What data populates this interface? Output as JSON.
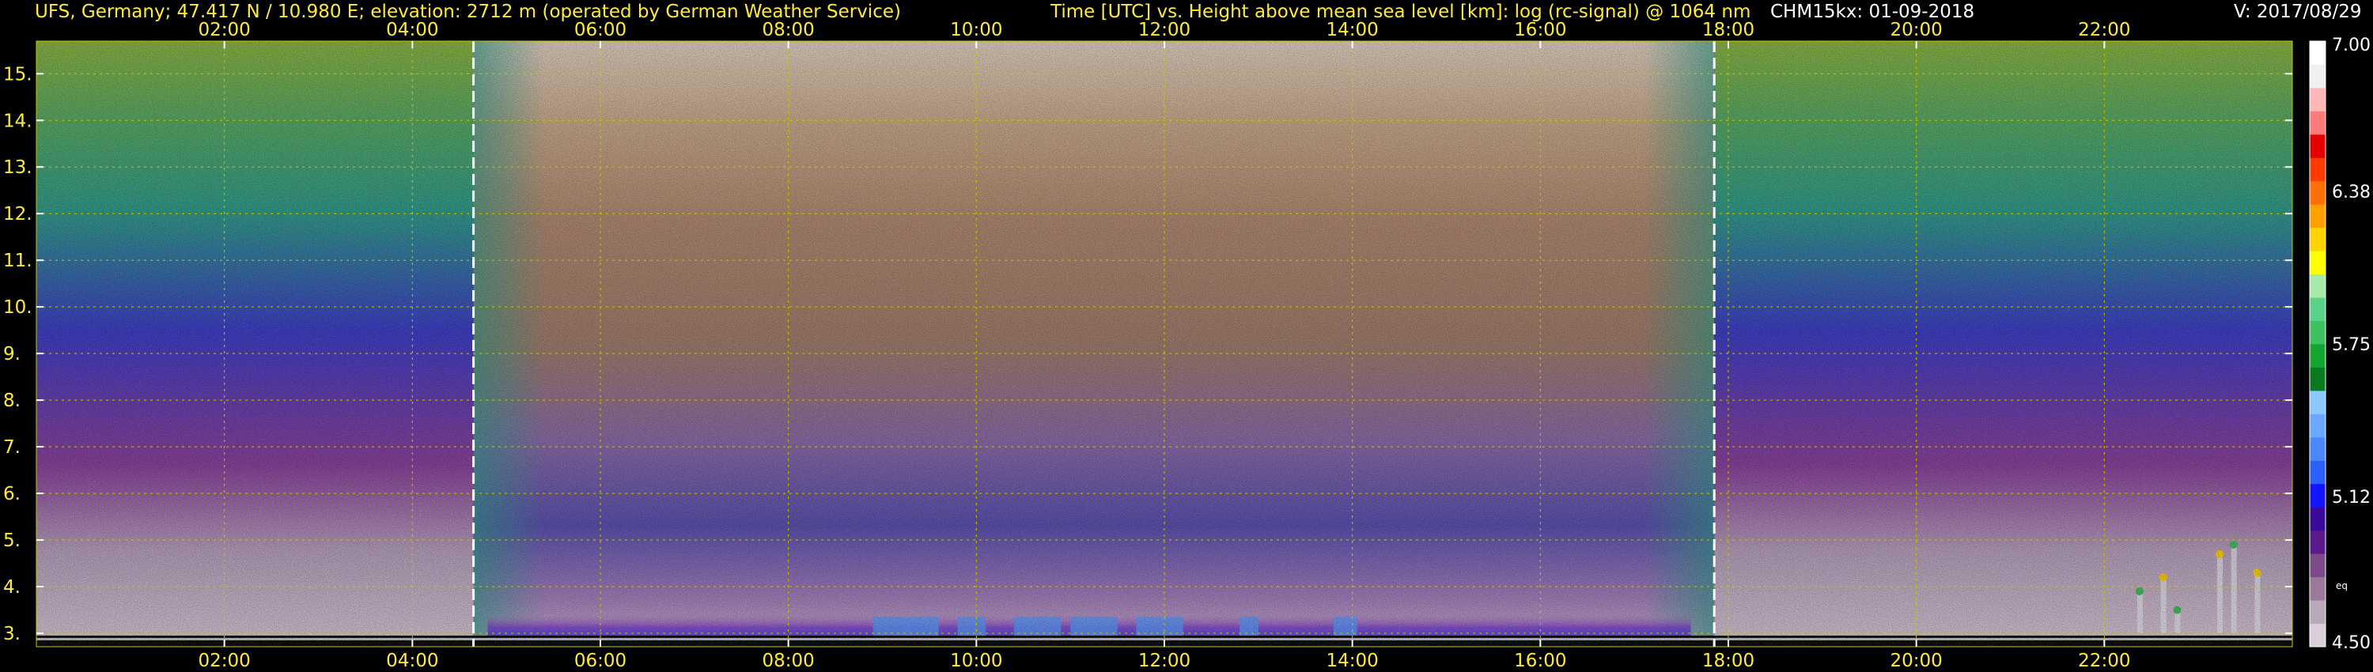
{
  "header": {
    "station": "UFS, Germany; 47.417 N / 10.980 E; elevation: 2712 m  (operated by German Weather Service)",
    "axis_description": "Time [UTC] vs. Height above mean sea level [km]: log (rc-signal) @ 1064 nm",
    "instrument_date": "CHM15kx: 01-09-2018",
    "version": "V: 2017/08/29"
  },
  "colors": {
    "header_left": "#ffeb3b",
    "header_center": "#ffeb3b",
    "header_right": "#ffffff",
    "tick_labels": "#ffeb3b",
    "grid": "#c8c800",
    "markers": "#ffffff",
    "colorbar_labels": "#ffffff"
  },
  "chart_data": {
    "type": "heatmap",
    "title": "Time [UTC] vs. Height above mean sea level [km]: log (rc-signal) @ 1064 nm",
    "xlabel": "",
    "ylabel": "",
    "x_unit": "hours UTC",
    "xlim": [
      0,
      24
    ],
    "x_ticks": [
      2,
      4,
      6,
      8,
      10,
      12,
      14,
      16,
      18,
      20,
      22
    ],
    "x_tick_labels": [
      "02:00",
      "04:00",
      "06:00",
      "08:00",
      "10:00",
      "12:00",
      "14:00",
      "16:00",
      "18:00",
      "20:00",
      "22:00"
    ],
    "ylim": [
      2.712,
      15.7
    ],
    "y_ticks": [
      3,
      4,
      5,
      6,
      7,
      8,
      9,
      10,
      11,
      12,
      13,
      14,
      15
    ],
    "y_tick_labels": [
      "3.",
      "4.",
      "5.",
      "6.",
      "7.",
      "8.",
      "9.",
      "10.",
      "11.",
      "12.",
      "13.",
      "14.",
      "15."
    ],
    "grid": true,
    "sunrise_marker_hour": 4.65,
    "sunset_marker_hour": 17.85,
    "colorbar": {
      "min": 4.5,
      "max": 7.0,
      "tick_values": [
        7.0,
        6.38,
        5.75,
        5.12,
        4.5
      ],
      "tick_labels": [
        "7.00",
        "6.38",
        "5.75",
        "5.12",
        "4.50"
      ],
      "small_label": "eq",
      "colors": [
        "#d9cfd9",
        "#b8a8b8",
        "#9a7a9a",
        "#7e4a8a",
        "#5a1a8a",
        "#3a0a9a",
        "#1414ff",
        "#2a60ff",
        "#4a88ff",
        "#6aa8ff",
        "#8ac8ff",
        "#0a7a20",
        "#12a530",
        "#3cc060",
        "#5ad28a",
        "#a8e8a8",
        "#ffff00",
        "#ffd200",
        "#ffa000",
        "#ff7000",
        "#ff3c00",
        "#e60000",
        "#ff7a7a",
        "#ffb6b6",
        "#f0f0f0",
        "#ffffff"
      ]
    },
    "features": [
      {
        "name": "nighttime background noise",
        "x_range": [
          0,
          4.65
        ],
        "dominant_colors": [
          "#d8c8d8",
          "#8a3f9b",
          "#3c3cc8",
          "#2e9c8a",
          "#8ab440"
        ]
      },
      {
        "name": "daytime background noise",
        "x_range": [
          4.65,
          17.85
        ],
        "dominant_colors": [
          "#5a4fb0",
          "#8a6aa8",
          "#b88a60",
          "#c8a878",
          "#e0d0b8"
        ]
      },
      {
        "name": "nighttime background noise",
        "x_range": [
          17.85,
          24
        ],
        "dominant_colors": [
          "#d8c8d8",
          "#8a3f9b",
          "#3c3cc8",
          "#2e9c8a",
          "#8ab440"
        ]
      },
      {
        "name": "boundary layer aerosol",
        "x_range": [
          4.8,
          17.6
        ],
        "y_range": [
          2.85,
          3.4
        ],
        "dominant_colors": [
          "#8a3fb0",
          "#3a3af0",
          "#5aa0ff"
        ]
      },
      {
        "name": "near-ground signal",
        "y_range": [
          2.75,
          2.95
        ],
        "dominant_colors": [
          "#0a0a0a",
          "#ffffff"
        ]
      },
      {
        "name": "clouds",
        "x_range": [
          22.2,
          23.8
        ],
        "y_range": [
          3.0,
          4.9
        ],
        "dominant_colors": [
          "#ffffff",
          "#ffd200",
          "#3cc060"
        ]
      }
    ]
  }
}
